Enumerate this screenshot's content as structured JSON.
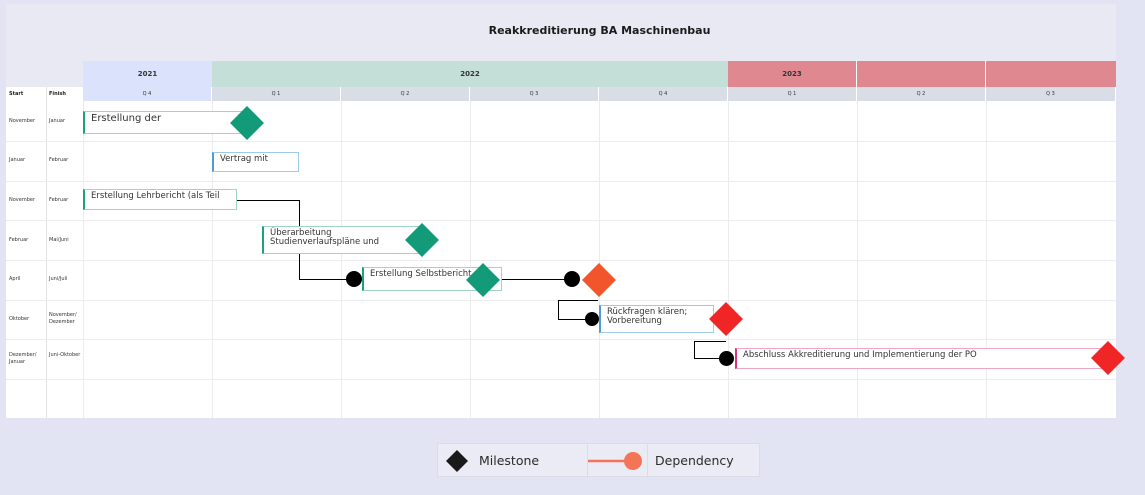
{
  "title": "Reakkreditierung BA Maschinenbau",
  "columns": {
    "start": "Start",
    "finish": "Finish"
  },
  "years": [
    {
      "label": "2021",
      "color": "#dbe2fb"
    },
    {
      "label": "2022",
      "color": "#c4ded8"
    },
    {
      "label": "2023",
      "color": "#e08890"
    }
  ],
  "quarters": [
    "Q 4",
    "Q 1",
    "Q 2",
    "Q 3",
    "Q 4",
    "Q 1",
    "Q 2",
    "Q 3"
  ],
  "rows": [
    {
      "start": "November",
      "finish": "Januar"
    },
    {
      "start": "Januar",
      "finish": "Februar"
    },
    {
      "start": "November",
      "finish": "Februar"
    },
    {
      "start": "Februar",
      "finish": "Mai/Juni"
    },
    {
      "start": "April",
      "finish": "Juni/Juli"
    },
    {
      "start": "Oktober",
      "finish": "November/ Dezember"
    },
    {
      "start": "Dezember/ Januar",
      "finish": "Juni-Oktober"
    }
  ],
  "tasks": [
    {
      "label": "Erstellung der",
      "accent": "#1aa17f"
    },
    {
      "label": "Vertrag mit",
      "accent": "#4e9bd8"
    },
    {
      "label": "Erstellung Lehrbericht (als Teil",
      "accent": "#1aa17f"
    },
    {
      "label": "Überarbeitung Studienverlaufspläne und",
      "accent": "#1aa17f"
    },
    {
      "label": "Erstellung Selbstbericht",
      "accent": "#1aa17f"
    },
    {
      "label": "Rückfragen klären; Vorbereitung",
      "accent": "#4e9bd8"
    },
    {
      "label": "Abschluss Akkreditierung und Implementierung der PO",
      "accent": "#d8307a"
    }
  ],
  "milestone_colors": {
    "green": "#139a79",
    "orange": "#f2552c",
    "red": "#f02525"
  },
  "legend": {
    "milestone": "Milestone",
    "dependency": "Dependency",
    "milestone_icon": "black-diamond-icon",
    "dependency_icon": "dependency-line-icon",
    "dependency_color": "#f47555"
  }
}
